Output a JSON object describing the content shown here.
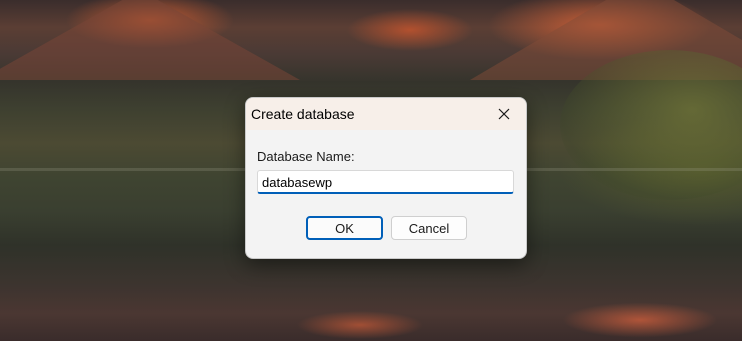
{
  "dialog": {
    "title": "Create database",
    "field_label": "Database Name:",
    "input_value": "databasewp",
    "ok_label": "OK",
    "cancel_label": "Cancel"
  },
  "icons": {
    "close": "close-icon"
  },
  "colors": {
    "accent": "#005fb8",
    "title_bar": "#f7efe9",
    "dialog_bg": "#f3f3f3"
  }
}
